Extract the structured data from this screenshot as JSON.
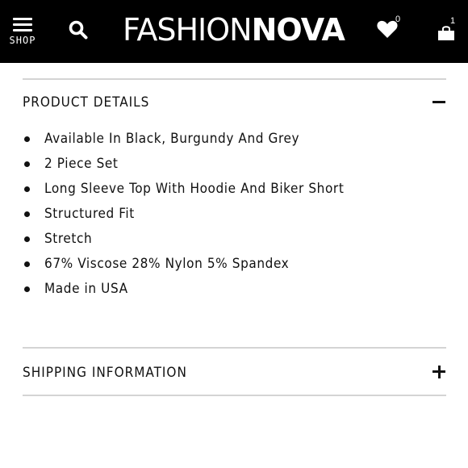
{
  "header": {
    "menu_label": "SHOP",
    "logo_thin": "FASHION",
    "logo_bold": "NOVA",
    "wishlist_count": "0",
    "cart_count": "1"
  },
  "sections": {
    "product_details": {
      "title": "PRODUCT DETAILS",
      "expanded": true,
      "items": [
        "Available In Black, Burgundy And Grey",
        "2 Piece Set",
        "Long Sleeve Top With Hoodie And Biker Short",
        "Structured Fit",
        "Stretch",
        "67% Viscose 28% Nylon 5% Spandex",
        "Made in USA"
      ]
    },
    "shipping": {
      "title": "SHIPPING INFORMATION",
      "expanded": false
    }
  },
  "icons": {
    "menu": "hamburger-icon",
    "search": "search-icon",
    "wishlist": "heart-icon",
    "cart": "shopping-bag-icon",
    "collapse": "minus-icon",
    "expand": "plus-icon"
  },
  "colors": {
    "header_bg": "#000000",
    "divider": "#d4d4d4",
    "text": "#111111"
  }
}
